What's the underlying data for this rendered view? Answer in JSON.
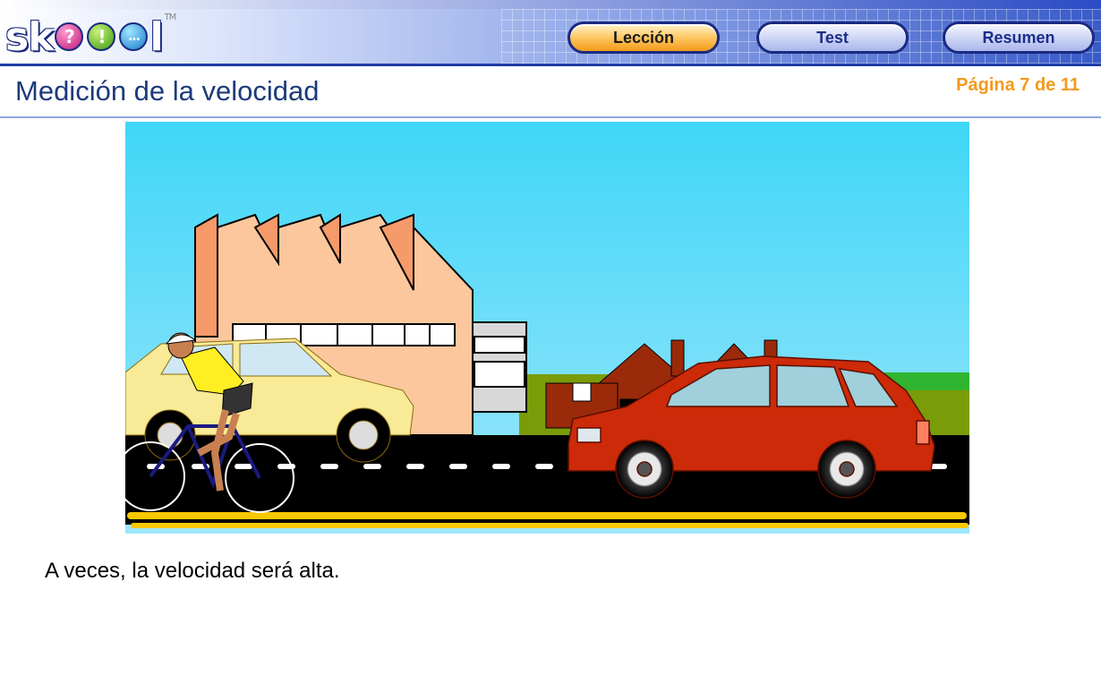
{
  "app": {
    "logo_text": "sk",
    "logo_tail": "l",
    "logo_balls": [
      "?",
      "!",
      "..."
    ],
    "logo_tm": "TM"
  },
  "nav": {
    "leccion": "Lección",
    "test": "Test",
    "resumen": "Resumen",
    "active": "leccion"
  },
  "page": {
    "title": "Medición de la velocidad",
    "page_indicator": "Página 7 de 11",
    "caption": "A veces, la velocidad será alta."
  },
  "colors": {
    "accent_orange": "#f29a1b",
    "title_blue": "#1c3a7a",
    "sky": "#55d4f5",
    "road": "#000000",
    "road_edge": "#f8c800",
    "red_car": "#cc2a08",
    "yellow_car": "#f8ea96",
    "factory": "#fcc79c"
  },
  "illustration": {
    "icons": [
      "factory",
      "houses",
      "cyclist",
      "yellow-car",
      "red-car",
      "road"
    ]
  }
}
